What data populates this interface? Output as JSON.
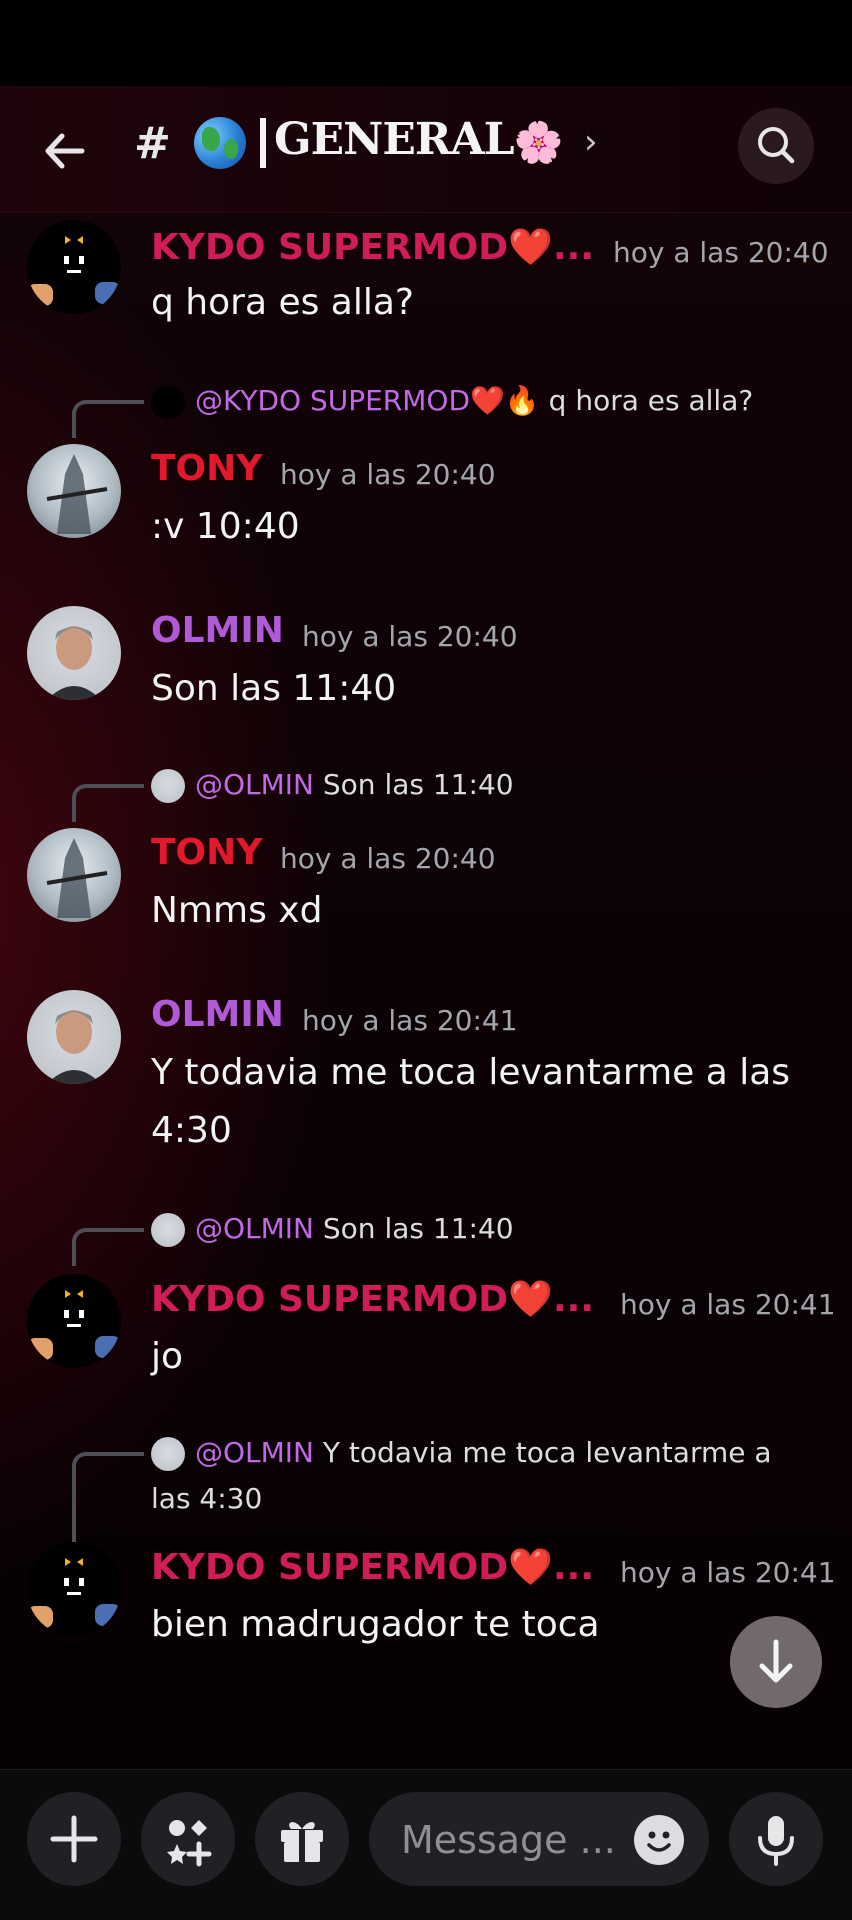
{
  "header": {
    "back_label": "Back",
    "hash": "#",
    "channel_name": "GENERAL",
    "flower": "🌸",
    "chevron": "›",
    "search_label": "Search"
  },
  "messages": [
    {
      "author": "KYDO SUPERMOD❤️...",
      "time": "hoy a las 20:40",
      "text": "q hora es alla?"
    },
    {
      "reply_to": "@KYDO SUPERMOD❤️🔥",
      "reply_text": "q hora es alla?",
      "author": "TONY",
      "time": "hoy a las 20:40",
      "text": ":v 10:40"
    },
    {
      "author": "OLMIN",
      "time": "hoy a las 20:40",
      "text": "Son las 11:40"
    },
    {
      "reply_to": "@OLMIN",
      "reply_text": "Son las 11:40",
      "author": "TONY",
      "time": "hoy a las 20:40",
      "text": "Nmms xd"
    },
    {
      "author": "OLMIN",
      "time": "hoy a las 20:41",
      "text_line1": "Y todavia me toca levantarme a las",
      "text_line2": "4:30"
    },
    {
      "reply_to": "@OLMIN",
      "reply_text": "Son las 11:40",
      "author": "KYDO SUPERMOD❤️...",
      "time": "hoy a las 20:41",
      "text": "jo"
    },
    {
      "reply_to": "@OLMIN",
      "reply_text_line1": "Y todavia me toca levantarme a",
      "reply_text_line2": "las 4:30",
      "author": "KYDO SUPERMOD❤️...",
      "time": "hoy a las 20:41",
      "text": "bien madrugador te toca"
    }
  ],
  "composer": {
    "placeholder": "Message ...",
    "icons": [
      "plus-icon",
      "apps-icon",
      "gift-icon",
      "emoji-icon",
      "microphone-icon"
    ]
  },
  "colors": {
    "kydo": "#d11c5c",
    "tony": "#e3182d",
    "olmin": "#b05ad8",
    "mention": "#c169e6"
  }
}
